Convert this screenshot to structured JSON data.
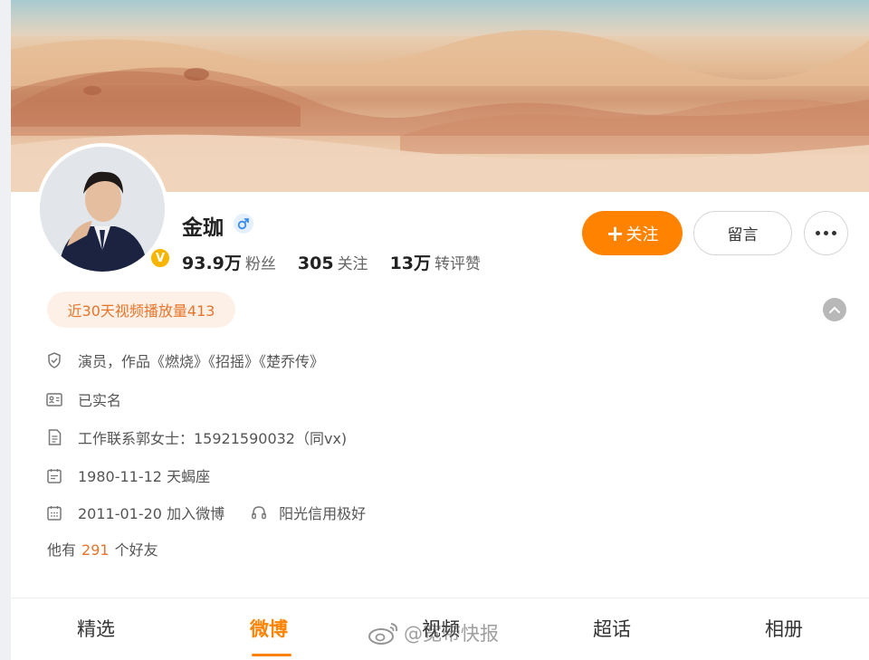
{
  "profile": {
    "name": "金珈",
    "verified_badge": "V",
    "stats": [
      {
        "value": "93.9万",
        "label": "粉丝"
      },
      {
        "value": "305",
        "label": "关注"
      },
      {
        "value": "13万",
        "label": "转评赞"
      }
    ]
  },
  "actions": {
    "follow_plus": "+",
    "follow_label": "关注",
    "message_label": "留言"
  },
  "highlight_pill": "近30天视频播放量413",
  "info_rows": [
    {
      "icon": "shield-check-icon",
      "text": "演员，作品《燃烧》《招摇》《楚乔传》"
    },
    {
      "icon": "id-card-icon",
      "text": "已实名"
    },
    {
      "icon": "document-icon",
      "text": "工作联系郭女士：15921590032（同vx)"
    },
    {
      "icon": "calendar-icon",
      "text": "1980-11-12 天蝎座"
    },
    {
      "icon": "calendar-grid-icon",
      "text": "2011-01-20 加入微博"
    },
    {
      "icon": "headset-icon",
      "text": "阳光信用极好"
    }
  ],
  "friends": {
    "prefix": "他有",
    "count": "291",
    "suffix": "个好友"
  },
  "tabs": [
    {
      "label": "精选",
      "active": false
    },
    {
      "label": "微博",
      "active": true
    },
    {
      "label": "视频",
      "active": false
    },
    {
      "label": "超话",
      "active": false
    },
    {
      "label": "相册",
      "active": false
    }
  ],
  "watermark": "@宽带快报",
  "colors": {
    "accent": "#ff8200",
    "highlight_text": "#e8742b",
    "verified": "#f7b500",
    "male_icon": "#3b8cf0"
  }
}
